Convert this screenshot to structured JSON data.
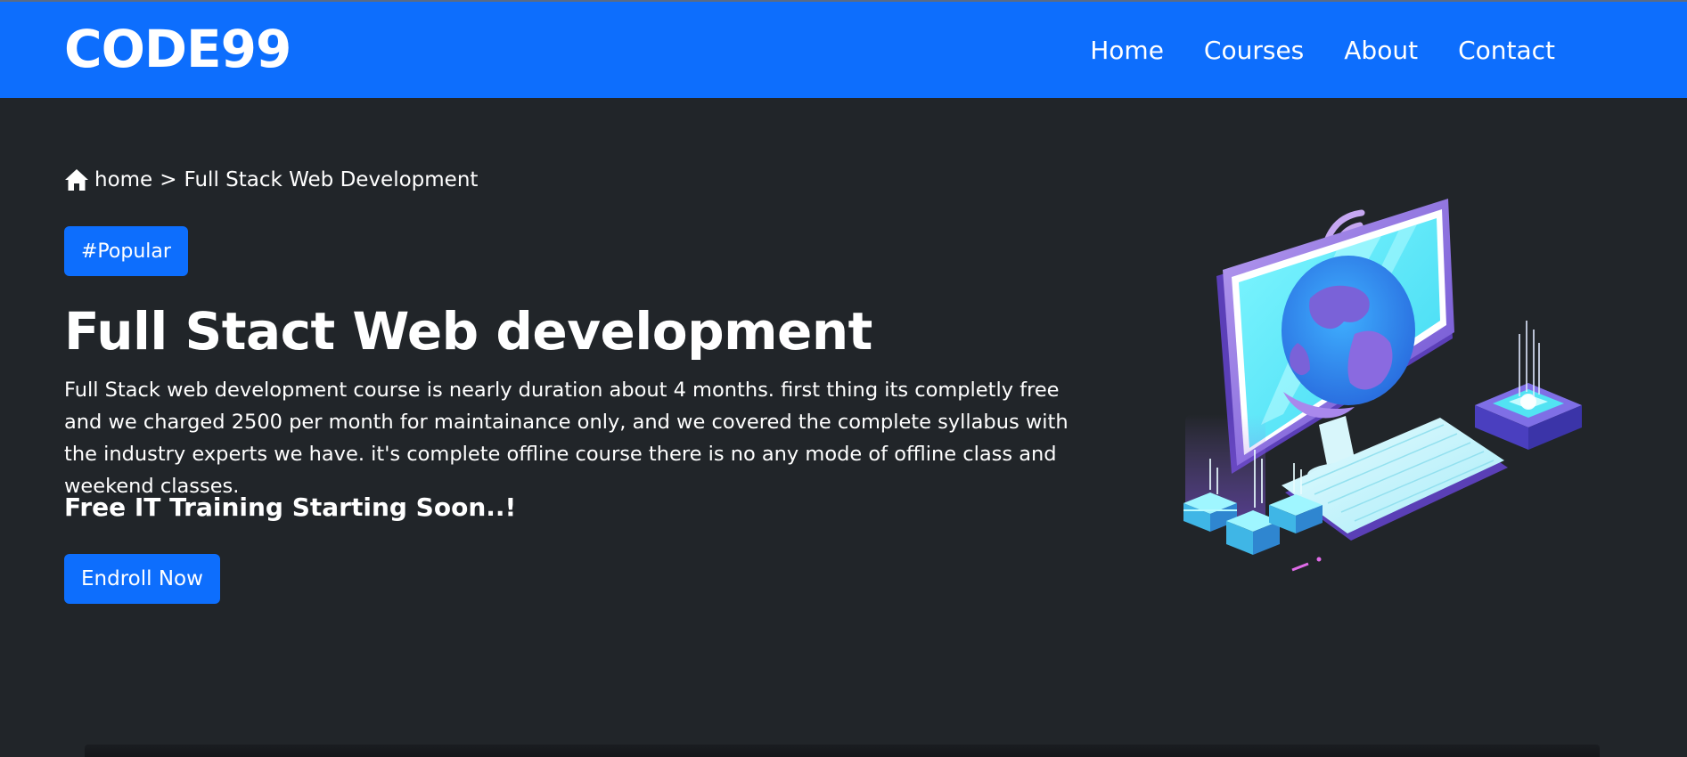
{
  "navbar": {
    "brand": "CODE99",
    "links": [
      "Home",
      "Courses",
      "About",
      "Contact"
    ]
  },
  "breadcrumb": {
    "home_icon": "home-icon",
    "home": "home",
    "separator": ">",
    "current": "Full Stack Web Development"
  },
  "hero": {
    "badge": "#Popular",
    "title": "Full Stact Web development",
    "description": "Full Stack web development course is nearly duration about 4 months. first thing its completly free and we charged 2500 per month for maintainance only, and we covered the complete syllabus with the industry experts we have. it's complete offline course there is no any mode of offline class and weekend classes.",
    "subtitle": "Free IT Training Starting Soon..!",
    "enroll_label": "Endroll Now"
  },
  "colors": {
    "primary": "#0d6efd",
    "background": "#212529",
    "text": "#ffffff"
  }
}
